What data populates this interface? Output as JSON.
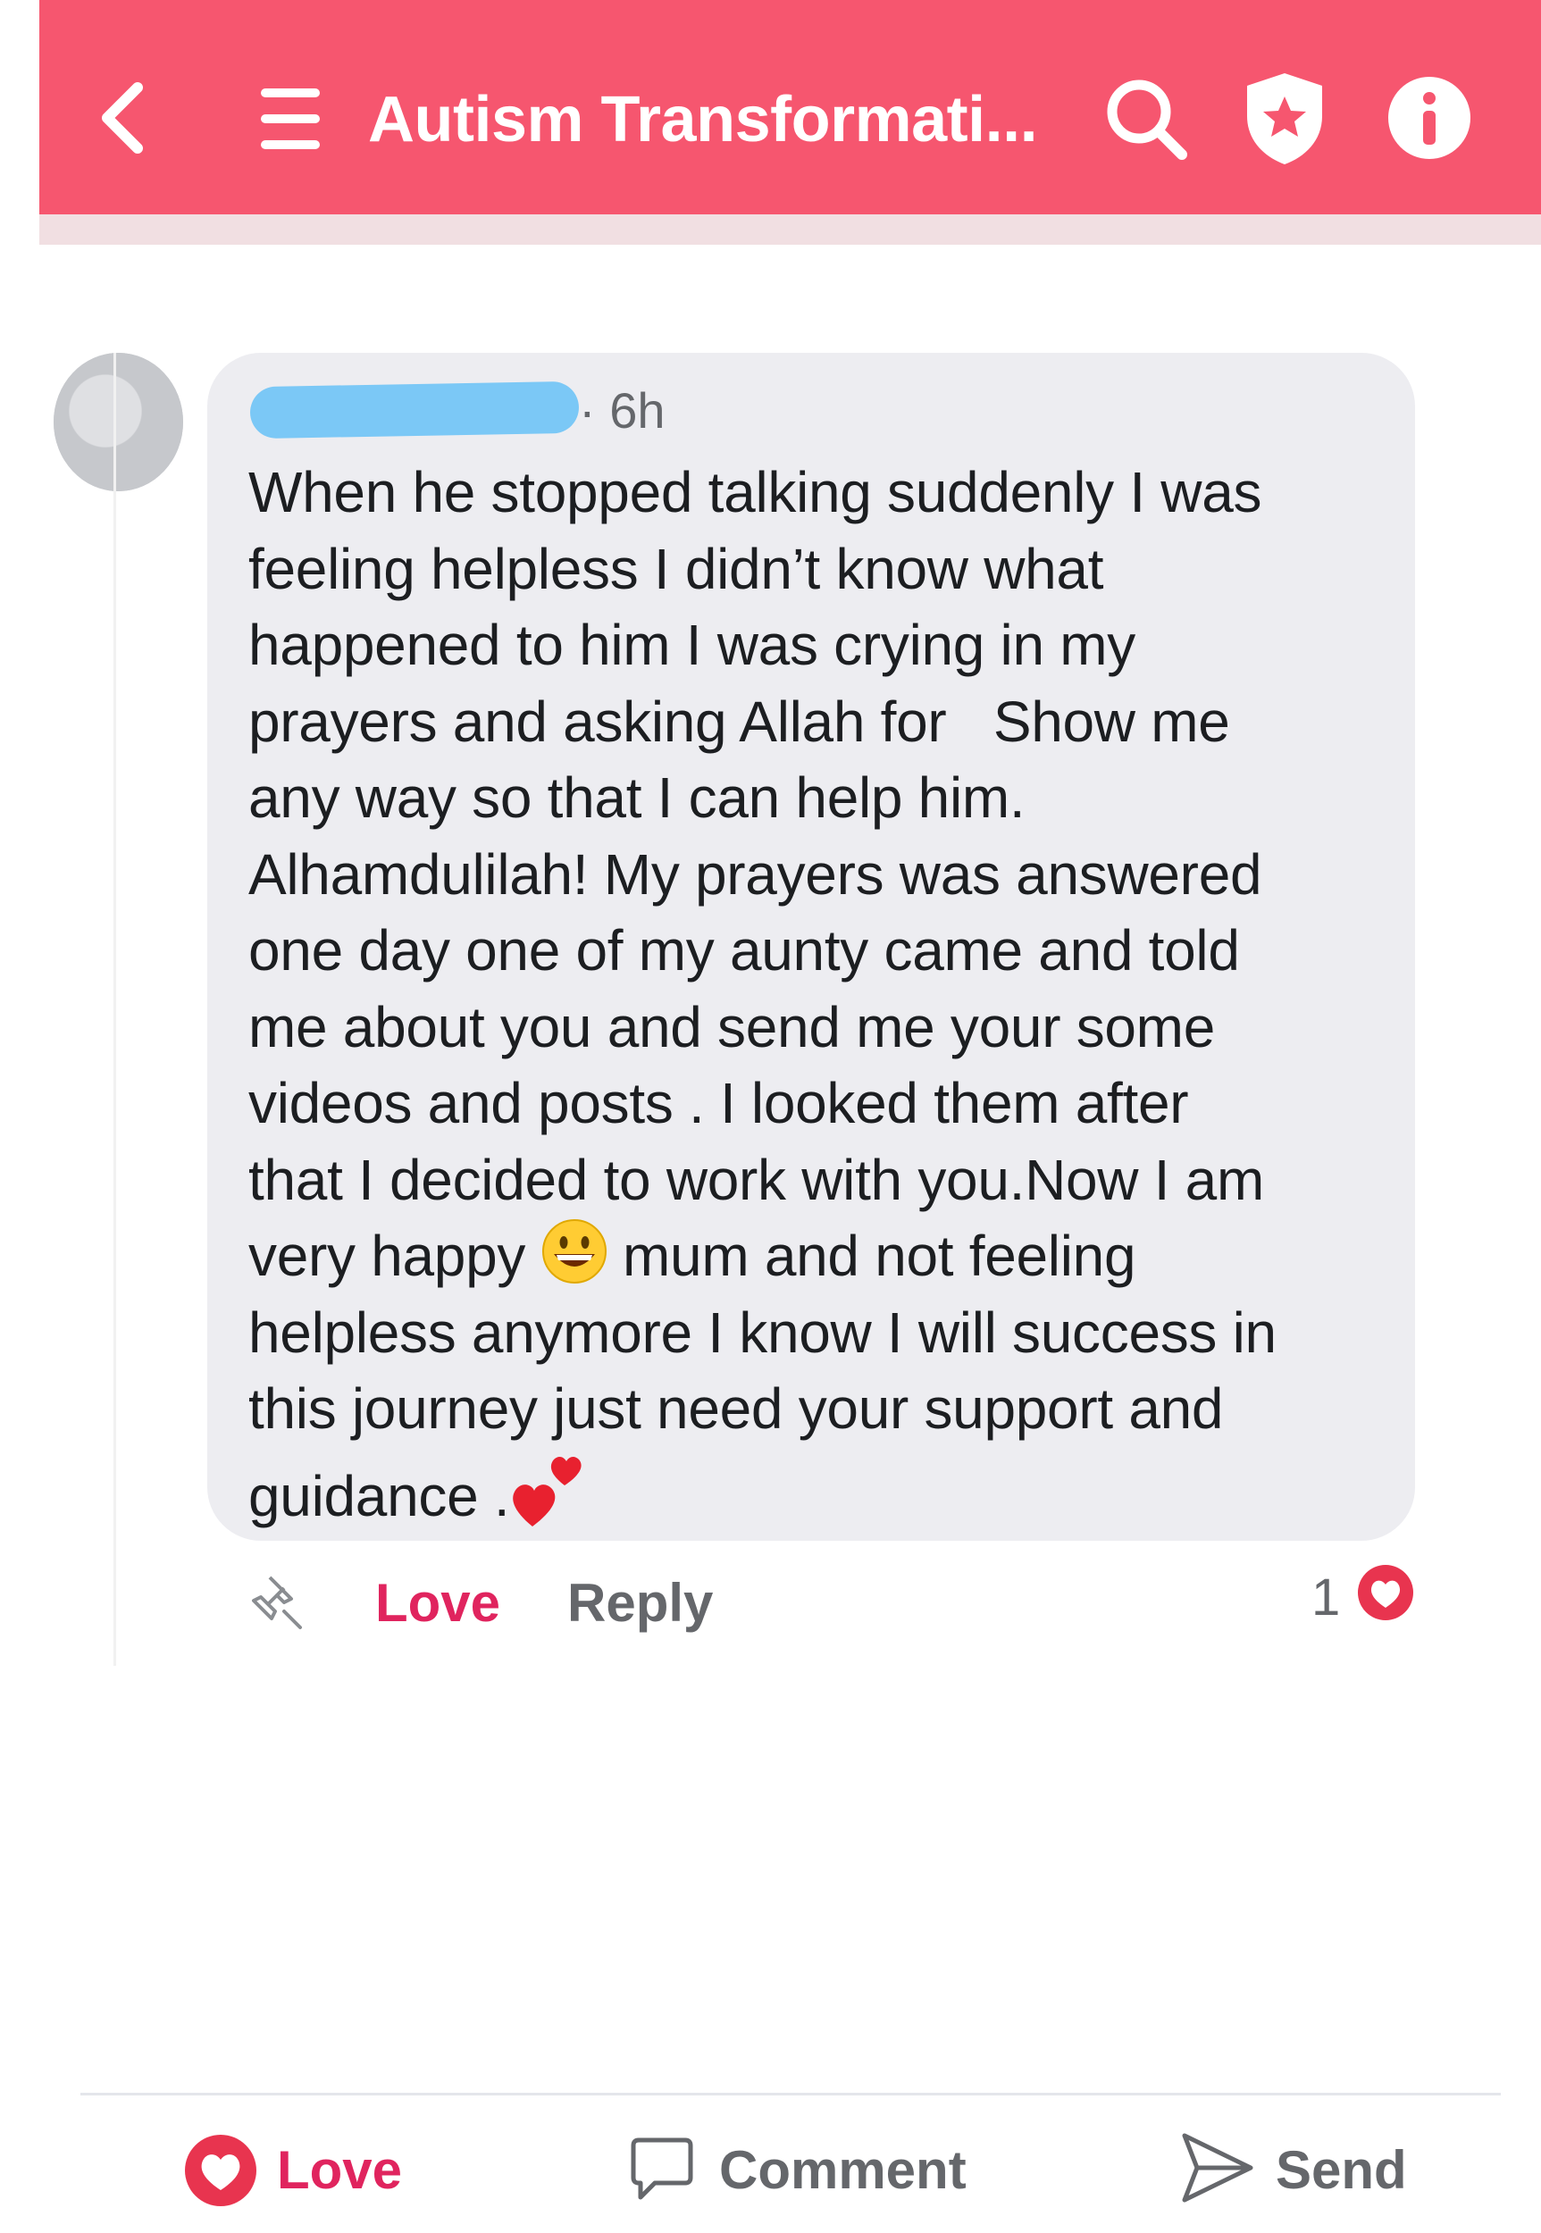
{
  "header": {
    "title": "Autism Transformati...",
    "background_color": "#f6566f",
    "icons": [
      "back-icon",
      "menu-icon",
      "search-icon",
      "shield-star-icon",
      "info-icon"
    ]
  },
  "comment": {
    "timestamp": "· 6h",
    "text_lines": [
      "When he stopped talking suddenly I was",
      "feeling helpless I didn’t know what",
      "happened to him I was crying in my",
      "prayers and asking Allah for   Show me",
      "any way so that I can help him.",
      "Alhamdulilah! My prayers was answered",
      "one day one of my aunty came and told",
      "me about you and send me your some",
      "videos and posts . I looked them after",
      "that I decided to work with you.Now I am"
    ],
    "line11_before": "very happy ",
    "line11_after": " mum and not feeling",
    "line12": "helpless anymore I know I will success in",
    "line13": "this journey just need your support and",
    "line14": "guidance .",
    "emojis": [
      "grinning-face-emoji",
      "two-hearts-emoji"
    ]
  },
  "actions": {
    "love_label": "Love",
    "reply_label": "Reply",
    "reaction_count": "1",
    "love_color": "#e0245e"
  },
  "bottom_bar": {
    "love_label": "Love",
    "comment_label": "Comment",
    "send_label": "Send"
  }
}
